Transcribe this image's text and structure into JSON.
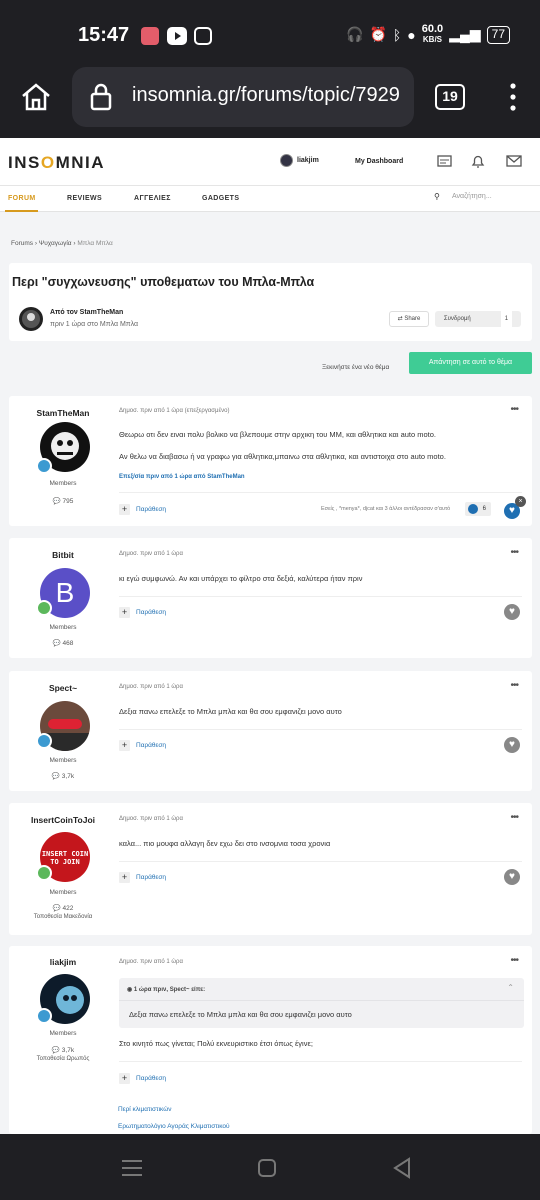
{
  "status": {
    "time": "15:47",
    "speed": "60.0",
    "speed_unit": "KB/S",
    "battery": "77"
  },
  "browser": {
    "url": "insomnia.gr/forums/topic/7929",
    "tabs": "19"
  },
  "site": {
    "logo_a": "INS",
    "logo_o": "O",
    "logo_b": "MNIA",
    "username": "liakjim",
    "dashboard": "My Dashboard"
  },
  "nav": {
    "items": [
      "FORUM",
      "REVIEWS",
      "ΑΓΓΕΛΙΕΣ",
      "GADGETS"
    ],
    "search_placeholder": "Αναζήτηση..."
  },
  "breadcrumb": {
    "a": "Forums",
    "b": "Ψυχαγωγία",
    "c": "Μπλα Μπλα"
  },
  "topic": {
    "title": "Περι \"συγχωνευσης\" υποθεματων του Μπλα-Μπλα",
    "by": "Από τον StamTheMan",
    "when": "πριν 1 ώρα στο Μπλα Μπλα",
    "share": "Share",
    "follow": "Συνδρομή",
    "follow_count": "1",
    "new_topic": "Ξεκινήστε ένα νέο θέμα",
    "reply": "Απάντηση σε αυτό το θέμα"
  },
  "posts": [
    {
      "name": "StamTheMan",
      "group": "Members",
      "count": "795",
      "date": "Δημοσ. πριν από 1 ώρα (επεξεργασμένο)",
      "lines": [
        "Θεωρω οτι δεν ειναι πολυ βολικο να βλεπουμε στην αρχικη του ΜΜ, και αθλητικα και auto moto.",
        "Αν θελω να διαβασω ή να γραφω για αθλητικα,μπαινω στα αθλητικα, και αντιστοιχα στο auto moto."
      ],
      "edit": "Επεξ/σία πριν από 1 ώρα από StamTheMan",
      "quote": "Παράθεση",
      "reacts": "Εσείς , *menya*, djcat και 3 άλλοι αντέδρασαν σ'αυτό",
      "react_count": "6"
    },
    {
      "name": "Bitbit",
      "group": "Members",
      "count": "468",
      "date": "Δημοσ. πριν από 1 ώρα",
      "lines": [
        "κι εγώ συμφωνώ. Αν και υπάρχει το φίλτρο στα δεξιά, καλύτερα ήταν πριν"
      ],
      "quote": "Παράθεση",
      "initial": "B"
    },
    {
      "name": "Spect~",
      "group": "Members",
      "count": "3,7k",
      "date": "Δημοσ. πριν από 1 ώρα",
      "lines": [
        "Δεξια πανω επελεξε το Μπλα μπλα και θα σου εμφανιζει μονο αυτο"
      ],
      "quote": "Παράθεση"
    },
    {
      "name": "InsertCoinToJoi",
      "group": "Members",
      "count": "422",
      "location": "Τοποθεσία Μακεδονία",
      "date": "Δημοσ. πριν από 1 ώρα",
      "lines": [
        "καλα... πιο μουφα αλλαγη δεν εχω δει στο ινσομνια τοσα χρονια"
      ],
      "quote": "Παράθεση"
    },
    {
      "name": "liakjim",
      "group": "Members",
      "count": "3,7k",
      "location": "Τοποθεσία Ωρωπός",
      "date": "Δημοσ. πριν από 1 ώρα",
      "quote_head": "1 ώρα πριν, Spect~ είπε:",
      "quote_body": "Δεξια πανω επελεξε το Μπλα μπλα και θα σου εμφανιζει μονο αυτο",
      "lines": [
        "Στο κινητό πως γίνεται;  Πολύ εκνευριστικο έτσι όπως έγινε;"
      ],
      "quote": "Παράθεση"
    }
  ],
  "related": [
    "Περί κλιματιστικών",
    "Ερωτηματολόγιο Αγοράς Κλιματιστικού"
  ],
  "colors": {
    "accent": "#d79a1e",
    "reply": "#3fcc95",
    "link": "#1f6fb2"
  }
}
